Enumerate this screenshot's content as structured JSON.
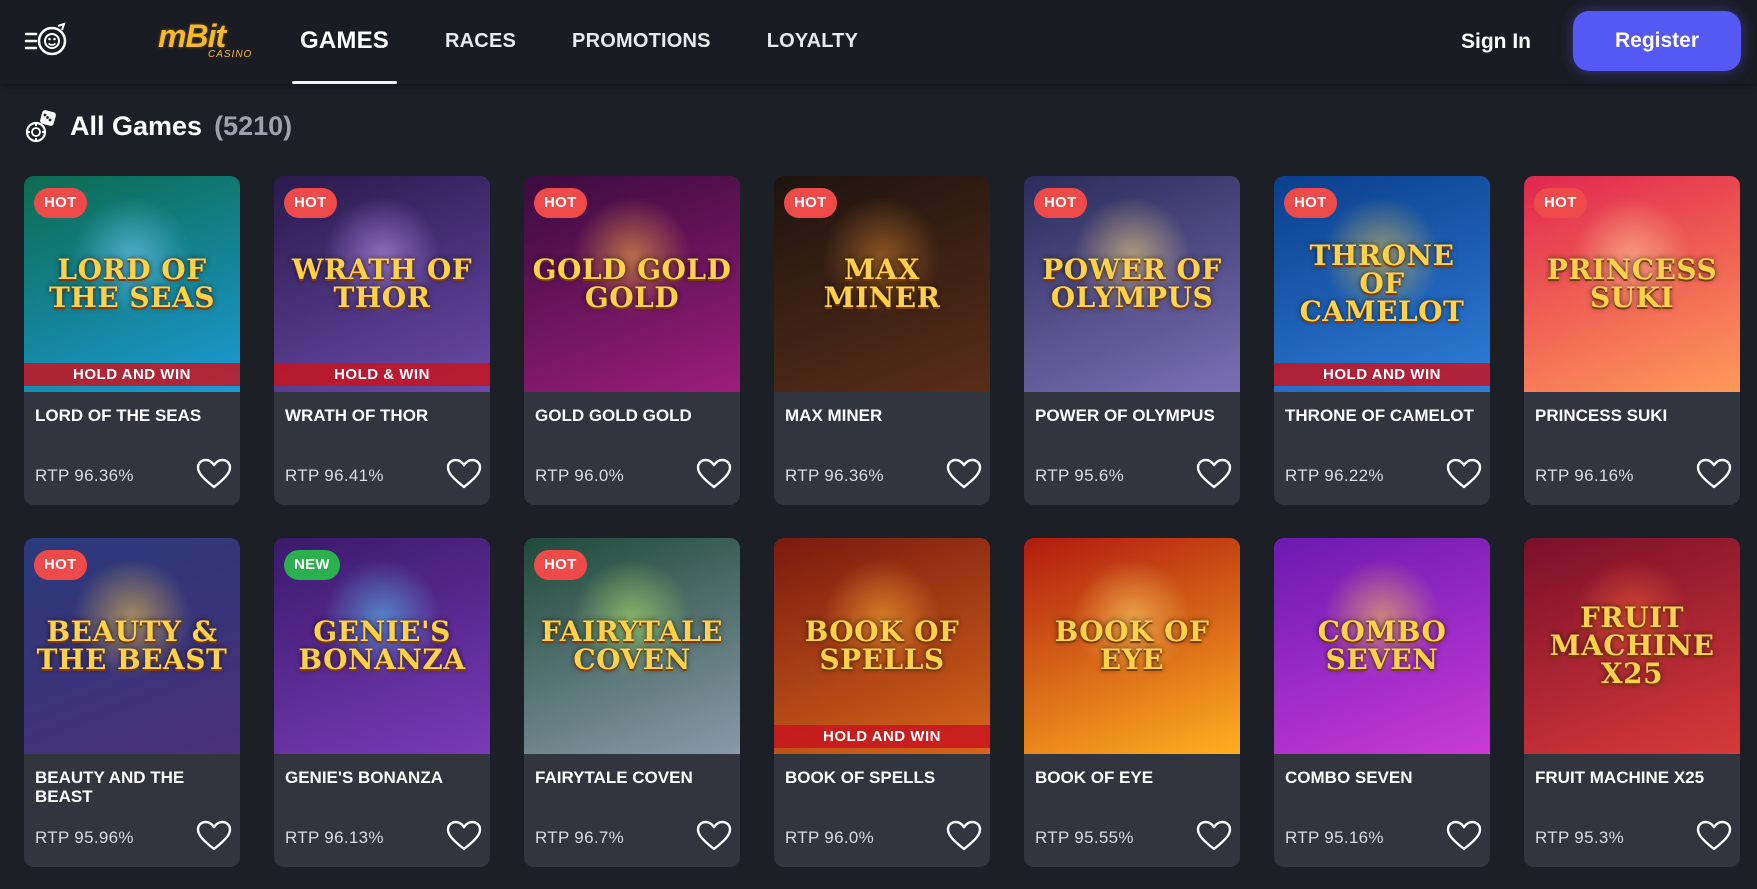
{
  "header": {
    "logo_main": "mBit",
    "logo_sub": "CASINO",
    "nav": [
      {
        "label": "GAMES",
        "active": true
      },
      {
        "label": "RACES",
        "active": false
      },
      {
        "label": "PROMOTIONS",
        "active": false
      },
      {
        "label": "LOYALTY",
        "active": false
      }
    ],
    "signin_label": "Sign In",
    "register_label": "Register"
  },
  "section": {
    "title": "All Games",
    "count": "(5210)"
  },
  "games": [
    {
      "name": "LORD OF THE SEAS",
      "rtp": "RTP 96.36%",
      "badge": "HOT",
      "art": "LORD OF THE SEAS",
      "art_sub": "HOLD AND WIN",
      "bg": [
        "#0d6b4f",
        "#1a9ad6"
      ],
      "glow": "#7fd0ff"
    },
    {
      "name": "WRATH OF THOR",
      "rtp": "RTP 96.41%",
      "badge": "HOT",
      "art": "WRATH OF THOR",
      "art_sub": "HOLD & WIN",
      "bg": [
        "#2a1a4d",
        "#6a4aa8"
      ],
      "glow": "#c9a2ff"
    },
    {
      "name": "GOLD GOLD GOLD",
      "rtp": "RTP 96.0%",
      "badge": "HOT",
      "art": "GOLD GOLD GOLD",
      "art_sub": "",
      "bg": [
        "#3a0b3f",
        "#9b1e7a"
      ],
      "glow": "#ffb43a"
    },
    {
      "name": "MAX MINER",
      "rtp": "RTP 96.36%",
      "badge": "HOT",
      "art": "MAX MINER",
      "art_sub": "",
      "bg": [
        "#1d1410",
        "#5a2d18"
      ],
      "glow": "#d08030"
    },
    {
      "name": "POWER OF OLYMPUS",
      "rtp": "RTP 95.6%",
      "badge": "HOT",
      "art": "POWER OF OLYMPUS",
      "art_sub": "",
      "bg": [
        "#2a2c5a",
        "#7b6fb4"
      ],
      "glow": "#ffe080"
    },
    {
      "name": "THRONE OF CAMELOT",
      "rtp": "RTP 96.22%",
      "badge": "HOT",
      "art": "THRONE OF CAMELOT",
      "art_sub": "HOLD AND WIN",
      "bg": [
        "#0b3e8c",
        "#2f7fd9"
      ],
      "glow": "#ffd24a"
    },
    {
      "name": "PRINCESS SUKI",
      "rtp": "RTP 96.16%",
      "badge": "HOT",
      "art": "PRINCESS SUKI",
      "art_sub": "",
      "bg": [
        "#e0274f",
        "#ff9a5a"
      ],
      "glow": "#ffd0a0"
    },
    {
      "name": "BEAUTY AND THE BEAST",
      "rtp": "RTP 95.96%",
      "badge": "HOT",
      "art": "BEAUTY & THE BEAST",
      "art_sub": "",
      "bg": [
        "#2a3a7a",
        "#4a2f7a"
      ],
      "glow": "#ffd24a"
    },
    {
      "name": "GENIE'S BONANZA",
      "rtp": "RTP 96.13%",
      "badge": "NEW",
      "art": "GENIE'S BONANZA",
      "art_sub": "",
      "bg": [
        "#3a1a6b",
        "#7a3ab8"
      ],
      "glow": "#5ad0ff"
    },
    {
      "name": "FAIRYTALE COVEN",
      "rtp": "RTP 96.7%",
      "badge": "HOT",
      "art": "FAIRYTALE COVEN",
      "art_sub": "",
      "bg": [
        "#1e4a3a",
        "#8a9aa8"
      ],
      "glow": "#b9f06a"
    },
    {
      "name": "BOOK OF SPELLS",
      "rtp": "RTP 96.0%",
      "badge": "",
      "art": "BOOK OF SPELLS",
      "art_sub": "HOLD AND WIN",
      "bg": [
        "#7a1a10",
        "#d8661a"
      ],
      "glow": "#ffb43a"
    },
    {
      "name": "BOOK OF EYE",
      "rtp": "RTP 95.55%",
      "badge": "",
      "art": "BOOK OF EYE",
      "art_sub": "",
      "bg": [
        "#b01a10",
        "#ffb020"
      ],
      "glow": "#ffe070"
    },
    {
      "name": "COMBO SEVEN",
      "rtp": "RTP 95.16%",
      "badge": "",
      "art": "COMBO SEVEN",
      "art_sub": "",
      "bg": [
        "#6a1ab0",
        "#c93ad8"
      ],
      "glow": "#ffd24a"
    },
    {
      "name": "FRUIT MACHINE X25",
      "rtp": "RTP 95.3%",
      "badge": "",
      "art": "FRUIT MACHINE X25",
      "art_sub": "",
      "bg": [
        "#7a0f2a",
        "#d83a3a"
      ],
      "glow": "#ff6a3a"
    }
  ]
}
